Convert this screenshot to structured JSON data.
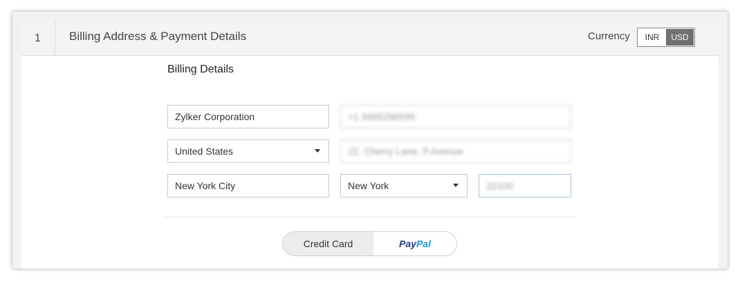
{
  "header": {
    "step_number": "1",
    "title": "Billing Address & Payment Details",
    "currency_label": "Currency",
    "currency_options": [
      "INR",
      "USD"
    ],
    "currency_selected": "USD"
  },
  "billing": {
    "title": "Billing Details",
    "company": "Zylker Corporation",
    "phone": "+1 9995296595",
    "country": "United States",
    "address": "22, Cherry Lane, P.Avenue",
    "city": "New York City",
    "state": "New York",
    "zip": "22100"
  },
  "payment": {
    "options": [
      "Credit Card",
      "PayPal"
    ],
    "selected": "Credit Card",
    "paypal_part1": "Pay",
    "paypal_part2": "Pal"
  },
  "colors": {
    "paypal_dark": "#253b80",
    "paypal_light": "#179bd7",
    "currency_active": "#707070"
  }
}
